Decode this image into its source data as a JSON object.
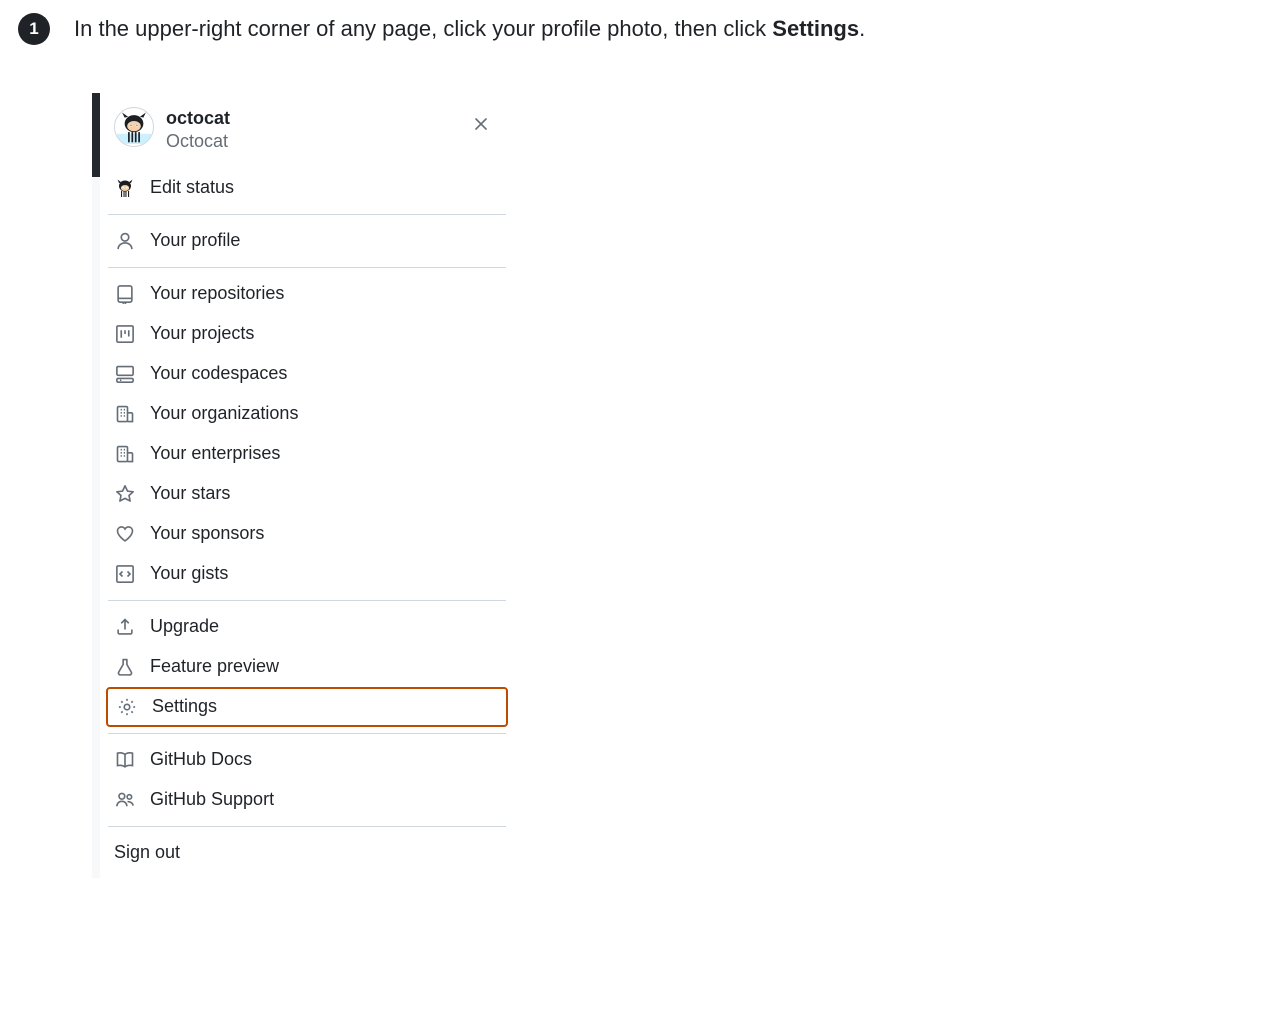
{
  "step": {
    "number": "1",
    "text_before": "In the upper-right corner of any page, click your profile photo, then click ",
    "text_bold": "Settings",
    "text_after": "."
  },
  "user": {
    "username": "octocat",
    "displayname": "Octocat"
  },
  "menu": {
    "edit_status": "Edit status",
    "your_profile": "Your profile",
    "your_repositories": "Your repositories",
    "your_projects": "Your projects",
    "your_codespaces": "Your codespaces",
    "your_organizations": "Your organizations",
    "your_enterprises": "Your enterprises",
    "your_stars": "Your stars",
    "your_sponsors": "Your sponsors",
    "your_gists": "Your gists",
    "upgrade": "Upgrade",
    "feature_preview": "Feature preview",
    "settings": "Settings",
    "github_docs": "GitHub Docs",
    "github_support": "GitHub Support",
    "sign_out": "Sign out"
  }
}
